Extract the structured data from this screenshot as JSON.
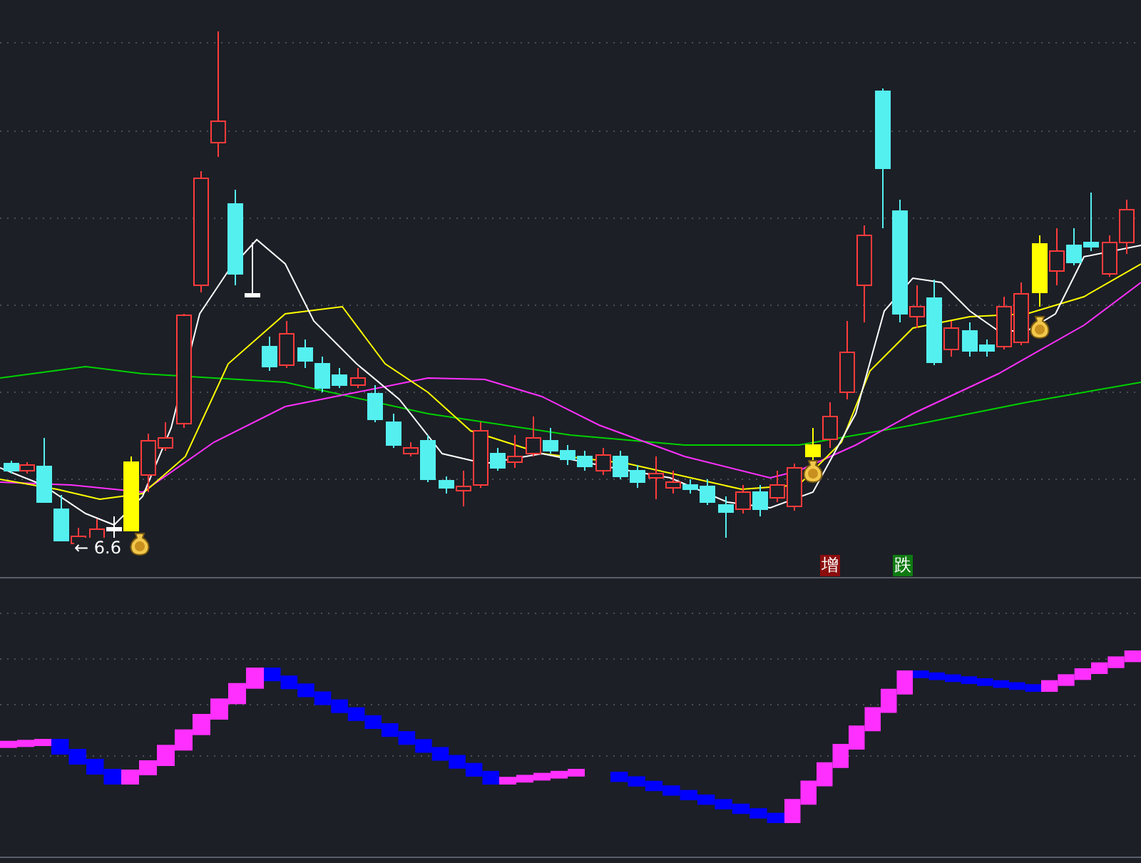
{
  "main_chart": {
    "price_label": "← 6.6",
    "markers": [
      {
        "text": "增",
        "kind": "up"
      },
      {
        "text": "跌",
        "kind": "down"
      }
    ]
  }
}
